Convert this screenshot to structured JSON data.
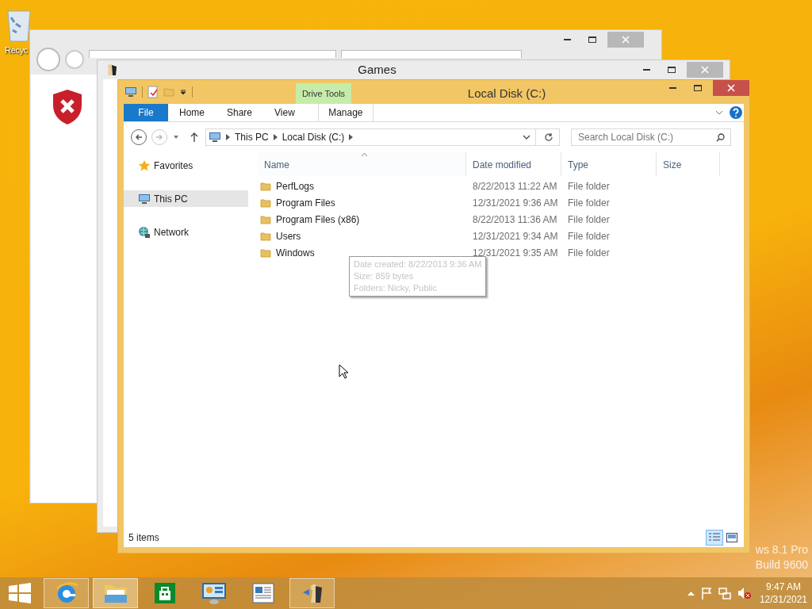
{
  "desktop": {
    "recycle_bin_label": "Recyc",
    "os_label": "ws 8.1 Pro",
    "build_label": "Build 9600"
  },
  "games_window": {
    "title": "Games"
  },
  "explorer": {
    "title": "Local Disk (C:)",
    "context_label": "Drive Tools",
    "ribbon_tabs": [
      {
        "label": "File",
        "kind": "file"
      },
      {
        "label": "Home",
        "kind": "plain"
      },
      {
        "label": "Share",
        "kind": "plain"
      },
      {
        "label": "View",
        "kind": "plain"
      },
      {
        "label": "Manage",
        "kind": "context"
      }
    ],
    "breadcrumb": [
      "This PC",
      "Local Disk (C:)"
    ],
    "search": {
      "placeholder": "Search Local Disk (C:)"
    },
    "nav": [
      {
        "label": "Favorites",
        "kind": "star",
        "selected": false
      },
      {
        "label": "This PC",
        "kind": "pc",
        "selected": true
      },
      {
        "label": "Network",
        "kind": "network",
        "selected": false
      }
    ],
    "columns": [
      {
        "label": "Name",
        "sorted": true
      },
      {
        "label": "Date modified",
        "sorted": false
      },
      {
        "label": "Type",
        "sorted": false
      },
      {
        "label": "Size",
        "sorted": false
      }
    ],
    "rows": [
      {
        "name": "PerfLogs",
        "date": "8/22/2013 11:22 AM",
        "type": "File folder"
      },
      {
        "name": "Program Files",
        "date": "12/31/2021 9:36 AM",
        "type": "File folder"
      },
      {
        "name": "Program Files (x86)",
        "date": "8/22/2013 11:36 AM",
        "type": "File folder"
      },
      {
        "name": "Users",
        "date": "12/31/2021 9:34 AM",
        "type": "File folder"
      },
      {
        "name": "Windows",
        "date": "12/31/2021 9:35 AM",
        "type": "File folder"
      }
    ],
    "tooltip": [
      "Date created: 8/22/2013 9:36 AM",
      "Size: 859 bytes",
      "Folders: Nicky, Public"
    ],
    "status": "5 items",
    "views": [
      {
        "kind": "details",
        "selected": true
      },
      {
        "kind": "tiles",
        "selected": false
      }
    ]
  },
  "taskbar": {
    "apps": [
      {
        "kind": "browser",
        "running": true,
        "selected": false
      },
      {
        "kind": "explorer",
        "running": true,
        "selected": true
      },
      {
        "kind": "store",
        "running": false,
        "selected": false
      },
      {
        "kind": "control",
        "running": false,
        "selected": false
      },
      {
        "kind": "reader",
        "running": false,
        "selected": false
      },
      {
        "kind": "games",
        "running": true,
        "selected": false
      }
    ],
    "time": "9:47 AM",
    "date": "12/31/2021"
  }
}
